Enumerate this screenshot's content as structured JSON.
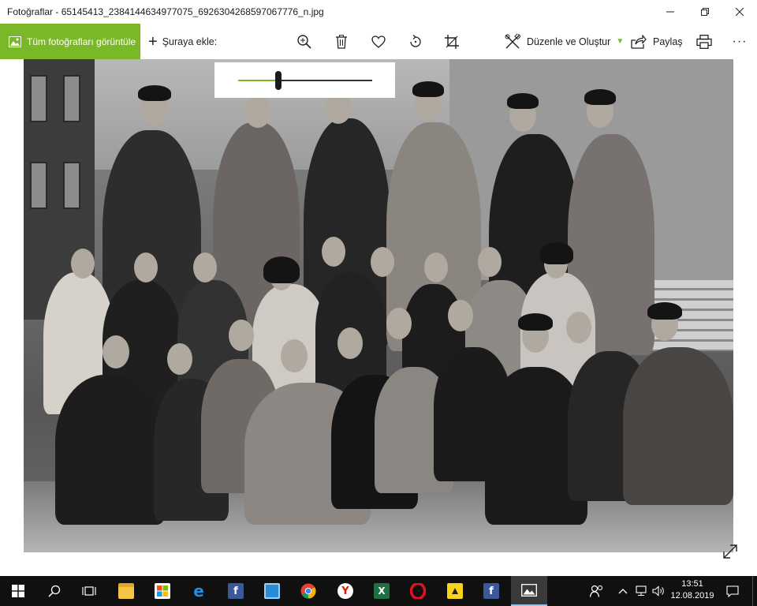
{
  "window": {
    "title": "Fotoğraflar - 65145413_2384144634977075_6926304268597067776_n.jpg",
    "minimize_symbol": "—",
    "controls": [
      "minimize-icon",
      "restore-icon",
      "close-icon"
    ]
  },
  "commandbar": {
    "all_photos_label": "Tüm fotoğrafları görüntüle",
    "add_to_label": "Şuraya ekle:",
    "edit_create_label": "Düzenle ve Oluştur",
    "share_label": "Paylaş",
    "icons": [
      "zoom-icon",
      "delete-icon",
      "favorite-icon",
      "rotate-icon",
      "crop-icon",
      "print-icon",
      "more-icon"
    ],
    "more_label": "···"
  },
  "zoom": {
    "level_fraction": 0.3
  },
  "taskbar": {
    "apps": [
      "start",
      "search",
      "task-view",
      "file-explorer",
      "store",
      "edge",
      "facebook",
      "network-app",
      "chrome",
      "yandex",
      "excel",
      "opera",
      "sticky-notes",
      "facebook-2",
      "photos"
    ],
    "time": "13:51",
    "date": "12.08.2019",
    "accent": "#7ab829"
  }
}
